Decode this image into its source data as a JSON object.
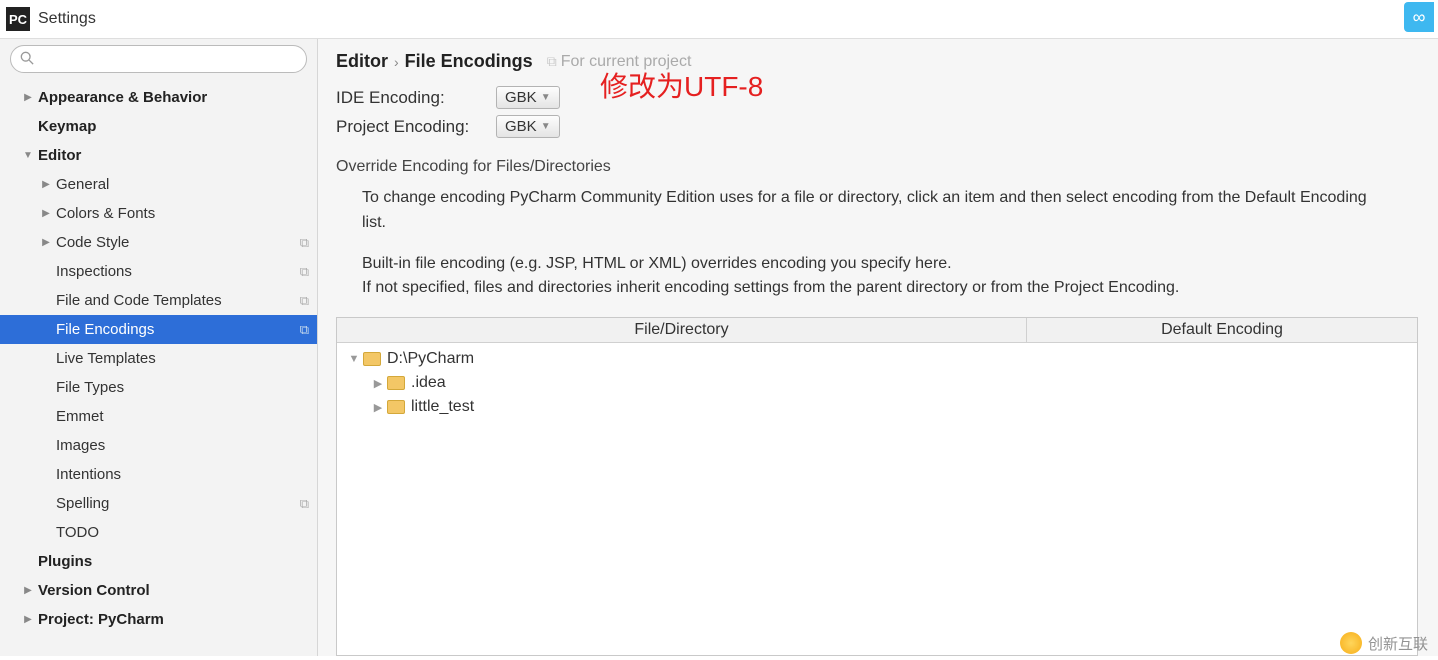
{
  "window": {
    "app_icon_text": "PC",
    "title": "Settings"
  },
  "search": {
    "placeholder": ""
  },
  "sidebar": [
    {
      "label": "Appearance & Behavior",
      "indent": 0,
      "bold": true,
      "arrow": "▶",
      "copy": false,
      "selected": false
    },
    {
      "label": "Keymap",
      "indent": 0,
      "bold": true,
      "arrow": "",
      "copy": false,
      "selected": false
    },
    {
      "label": "Editor",
      "indent": 0,
      "bold": true,
      "arrow": "▼",
      "copy": false,
      "selected": false
    },
    {
      "label": "General",
      "indent": 1,
      "bold": false,
      "arrow": "▶",
      "copy": false,
      "selected": false
    },
    {
      "label": "Colors & Fonts",
      "indent": 1,
      "bold": false,
      "arrow": "▶",
      "copy": false,
      "selected": false
    },
    {
      "label": "Code Style",
      "indent": 1,
      "bold": false,
      "arrow": "▶",
      "copy": true,
      "selected": false
    },
    {
      "label": "Inspections",
      "indent": 1,
      "bold": false,
      "arrow": "",
      "copy": true,
      "selected": false
    },
    {
      "label": "File and Code Templates",
      "indent": 1,
      "bold": false,
      "arrow": "",
      "copy": true,
      "selected": false
    },
    {
      "label": "File Encodings",
      "indent": 1,
      "bold": false,
      "arrow": "",
      "copy": true,
      "selected": true
    },
    {
      "label": "Live Templates",
      "indent": 1,
      "bold": false,
      "arrow": "",
      "copy": false,
      "selected": false
    },
    {
      "label": "File Types",
      "indent": 1,
      "bold": false,
      "arrow": "",
      "copy": false,
      "selected": false
    },
    {
      "label": "Emmet",
      "indent": 1,
      "bold": false,
      "arrow": "",
      "copy": false,
      "selected": false
    },
    {
      "label": "Images",
      "indent": 1,
      "bold": false,
      "arrow": "",
      "copy": false,
      "selected": false
    },
    {
      "label": "Intentions",
      "indent": 1,
      "bold": false,
      "arrow": "",
      "copy": false,
      "selected": false
    },
    {
      "label": "Spelling",
      "indent": 1,
      "bold": false,
      "arrow": "",
      "copy": true,
      "selected": false
    },
    {
      "label": "TODO",
      "indent": 1,
      "bold": false,
      "arrow": "",
      "copy": false,
      "selected": false
    },
    {
      "label": "Plugins",
      "indent": 0,
      "bold": true,
      "arrow": "",
      "copy": false,
      "selected": false
    },
    {
      "label": "Version Control",
      "indent": 0,
      "bold": true,
      "arrow": "▶",
      "copy": false,
      "selected": false
    },
    {
      "label": "Project: PyCharm",
      "indent": 0,
      "bold": true,
      "arrow": "▶",
      "copy": false,
      "selected": false
    }
  ],
  "breadcrumb": {
    "root": "Editor",
    "leaf": "File Encodings",
    "hint": "For current project"
  },
  "annotation": {
    "text": "修改为UTF-8"
  },
  "form": {
    "ide_label": "IDE Encoding:",
    "ide_value": "GBK",
    "proj_label": "Project Encoding:",
    "proj_value": "GBK"
  },
  "override": {
    "title": "Override Encoding for Files/Directories",
    "help1": "To change encoding PyCharm Community Edition uses for a file or directory, click an item and then select encoding from the Default Encoding list.",
    "help2": "Built-in file encoding (e.g. JSP, HTML or XML) overrides encoding you specify here.\nIf not specified, files and directories inherit encoding settings from the parent directory or from the Project Encoding."
  },
  "table": {
    "col1": "File/Directory",
    "col2": "Default Encoding",
    "rows": [
      {
        "name": "D:\\PyCharm",
        "indent": 0,
        "arrow": "▼"
      },
      {
        "name": ".idea",
        "indent": 1,
        "arrow": "▶"
      },
      {
        "name": "little_test",
        "indent": 1,
        "arrow": "▶"
      }
    ]
  },
  "watermark": "创新互联"
}
